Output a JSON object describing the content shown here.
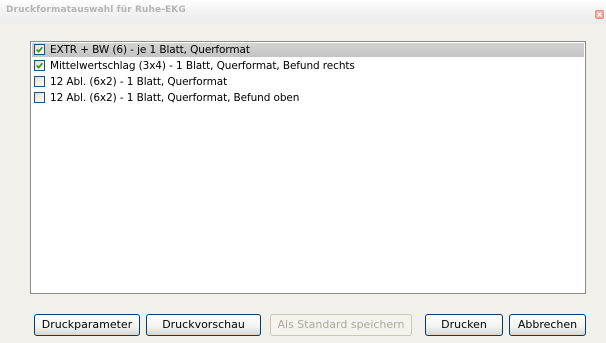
{
  "window": {
    "title": "Druckformatauswahl für Ruhe-EKG"
  },
  "list": {
    "items": [
      {
        "label": "EXTR + BW (6) - je 1 Blatt, Querformat",
        "checked": true,
        "selected": true
      },
      {
        "label": "Mittelwertschlag (3x4) - 1 Blatt, Querformat, Befund rechts",
        "checked": true,
        "selected": false
      },
      {
        "label": "12 Abl. (6x2) - 1 Blatt, Querformat",
        "checked": false,
        "selected": false
      },
      {
        "label": "12 Abl. (6x2) - 1 Blatt, Querformat, Befund oben",
        "checked": false,
        "selected": false
      }
    ]
  },
  "buttons": {
    "druckparameter": "Druckparameter",
    "druckvorschau": "Druckvorschau",
    "als_standard_speichern": "Als Standard speichern",
    "drucken": "Drucken",
    "abbrechen": "Abbrechen"
  },
  "colors": {
    "selection": "#c8c8c8",
    "checkmark": "#21a121",
    "close_button": "#f2a9a0"
  },
  "icons": {
    "close": "close-icon",
    "check": "checkmark-icon"
  }
}
